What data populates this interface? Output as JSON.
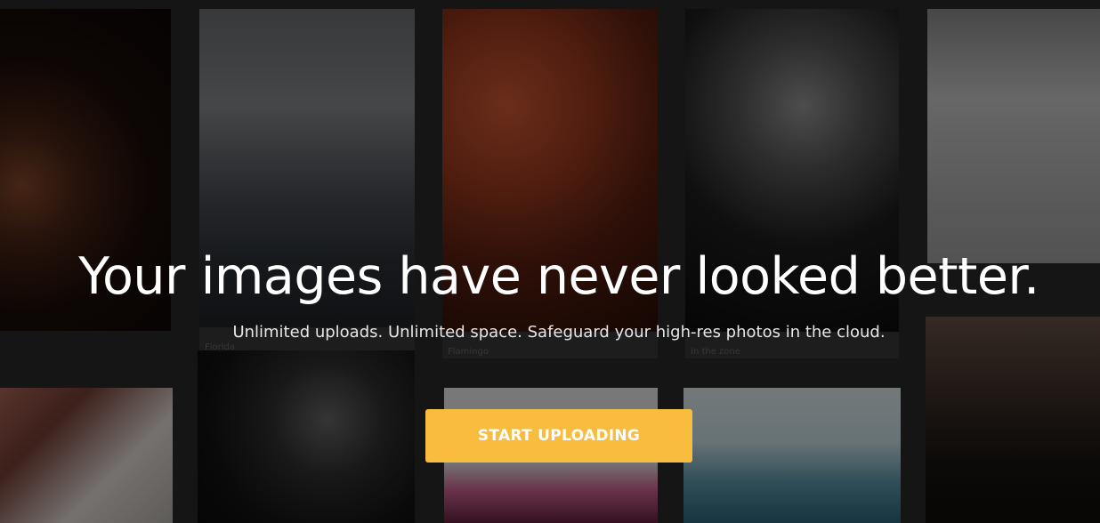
{
  "hero": {
    "headline": "Your images have never looked better.",
    "subheadline": "Unlimited uploads. Unlimited space. Safeguard your high-res photos in the cloud.",
    "cta_label": "START UPLOADING"
  },
  "gallery": {
    "captions": {
      "florida": "Florida",
      "flamingo": "Flamingo",
      "in_the_zone": "In the zone"
    }
  },
  "colors": {
    "cta_background": "#F8BC3F",
    "overlay": "#000000"
  }
}
